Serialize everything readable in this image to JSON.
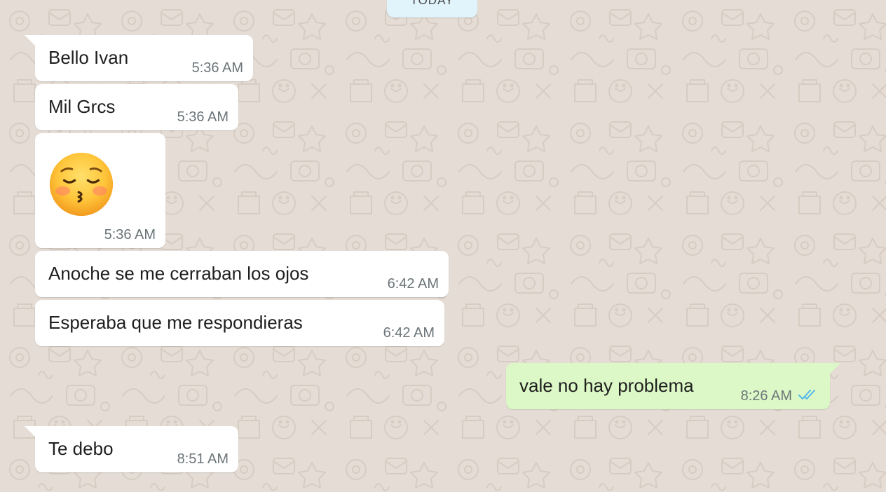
{
  "date_separator": "TODAY",
  "messages": [
    {
      "direction": "in",
      "text": "Bello Ivan",
      "time": "5:36 AM"
    },
    {
      "direction": "in",
      "text": "Mil Grcs",
      "time": "5:36 AM"
    },
    {
      "direction": "in",
      "emoji": "kissing-face-with-closed-eyes",
      "time": "5:36 AM"
    },
    {
      "direction": "in",
      "text": "Anoche se me cerraban los ojos",
      "time": "6:42 AM"
    },
    {
      "direction": "in",
      "text": "Esperaba que me respondieras",
      "time": "6:42 AM"
    },
    {
      "direction": "out",
      "text": "vale no hay problema",
      "time": "8:26 AM",
      "status": "read"
    },
    {
      "direction": "in",
      "text": "Te debo",
      "time": "8:51 AM"
    }
  ],
  "colors": {
    "wallpaper": "#e5ddd5",
    "incoming_bubble": "#ffffff",
    "outgoing_bubble": "#dcf8c6",
    "date_chip": "#e1f3fb",
    "read_ticks": "#4fb6ec"
  }
}
